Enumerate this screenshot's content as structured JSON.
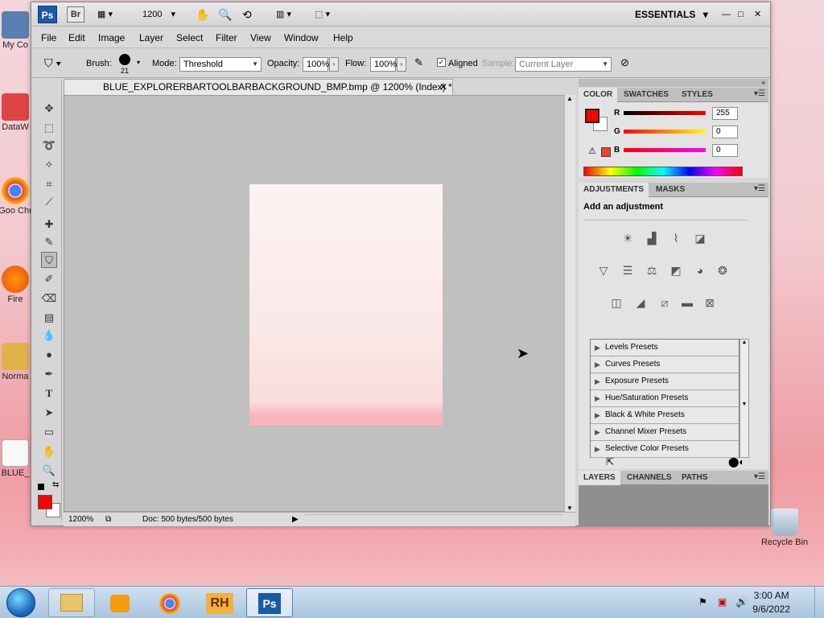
{
  "desktop": {
    "icons": [
      {
        "label": "My Co"
      },
      {
        "label": "DataW"
      },
      {
        "label": "Goo Chr"
      },
      {
        "label": "Fire"
      },
      {
        "label": "Norma"
      },
      {
        "label": "BLUE_"
      }
    ],
    "recycle_bin": "Recycle Bin"
  },
  "appbar": {
    "ps": "Ps",
    "br": "Br",
    "zoom": "1200",
    "workspace": "ESSENTIALS"
  },
  "menu": [
    "File",
    "Edit",
    "Image",
    "Layer",
    "Select",
    "Filter",
    "View",
    "Window",
    "Help"
  ],
  "options": {
    "brush_label": "Brush:",
    "brush_size": "21",
    "mode_label": "Mode:",
    "mode_value": "Threshold",
    "opacity_label": "Opacity:",
    "opacity_value": "100%",
    "flow_label": "Flow:",
    "flow_value": "100%",
    "aligned_label": "Aligned",
    "sample_label": "Sample:",
    "sample_value": "Current Layer"
  },
  "document": {
    "title": "BLUE_EXPLORERBARTOOLBARBACKGROUND_BMP.bmp @ 1200% (Index) *",
    "zoom": "1200%",
    "doc_info": "Doc: 500 bytes/500 bytes"
  },
  "panels": {
    "color_tabs": [
      "COLOR",
      "SWATCHES",
      "STYLES"
    ],
    "r_label": "R",
    "g_label": "G",
    "b_label": "B",
    "r": "255",
    "g": "0",
    "b": "0",
    "adjust_tabs": [
      "ADJUSTMENTS",
      "MASKS"
    ],
    "add_adjustment": "Add an adjustment",
    "presets": [
      "Levels Presets",
      "Curves Presets",
      "Exposure Presets",
      "Hue/Saturation Presets",
      "Black & White Presets",
      "Channel Mixer Presets",
      "Selective Color Presets"
    ],
    "layer_tabs": [
      "LAYERS",
      "CHANNELS",
      "PATHS"
    ]
  },
  "taskbar": {
    "time": "3:00 AM",
    "date": "9/6/2022"
  },
  "colors": {
    "foreground": "#ff0000",
    "background": "#ffffff"
  }
}
